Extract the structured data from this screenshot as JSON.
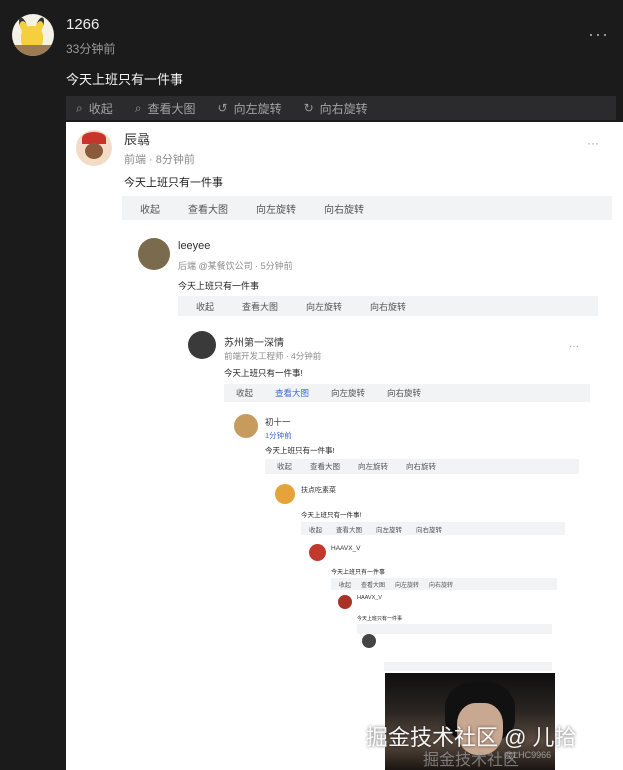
{
  "post": {
    "user": "1266",
    "time": "33分钟前",
    "text": "今天上班只有一件事",
    "more": "···",
    "toolbar": [
      "收起",
      "查看大图",
      "向左旋转",
      "向右旋转"
    ]
  },
  "levels": [
    {
      "user": "辰骉",
      "meta": "前端 · 8分钟前",
      "text": "今天上班只有一件事",
      "toolbar": [
        "收起",
        "查看大图",
        "向左旋转",
        "向右旋转"
      ]
    },
    {
      "user": "leeyee",
      "meta": "后端 @某餐饮公司 · 5分钟前",
      "text": "今天上班只有一件事",
      "toolbar": [
        "收起",
        "查看大图",
        "向左旋转",
        "向右旋转"
      ]
    },
    {
      "user": "苏州第一深情",
      "meta": "前端开发工程师 · 4分钟前",
      "text": "今天上班只有一件事!",
      "toolbar": [
        "收起",
        "查看大图",
        "向左旋转",
        "向右旋转"
      ]
    },
    {
      "user": "初十一",
      "meta": "1分钟前",
      "text": "今天上班只有一件事!",
      "toolbar": [
        "收起",
        "查看大图",
        "向左旋转",
        "向右旋转"
      ]
    },
    {
      "user": "扶点吃素菜",
      "meta": "",
      "text": "今天上班只有一件事!",
      "toolbar": [
        "收起",
        "查看大图",
        "向左旋转",
        "向右旋转"
      ]
    },
    {
      "user": "HAAVX_V",
      "meta": "",
      "text": "今天上班只有一件事",
      "toolbar": [
        "收起",
        "查看大图",
        "向左旋转",
        "向右旋转"
      ]
    },
    {
      "user": "HAAVX_V",
      "meta": "",
      "text": "今天上班只有一件事",
      "toolbar": []
    }
  ],
  "watermark": "掘金技术社区 @ 儿拾",
  "watermark_ghost": "掘金技术社区",
  "watermark_small": "@LHC9966"
}
